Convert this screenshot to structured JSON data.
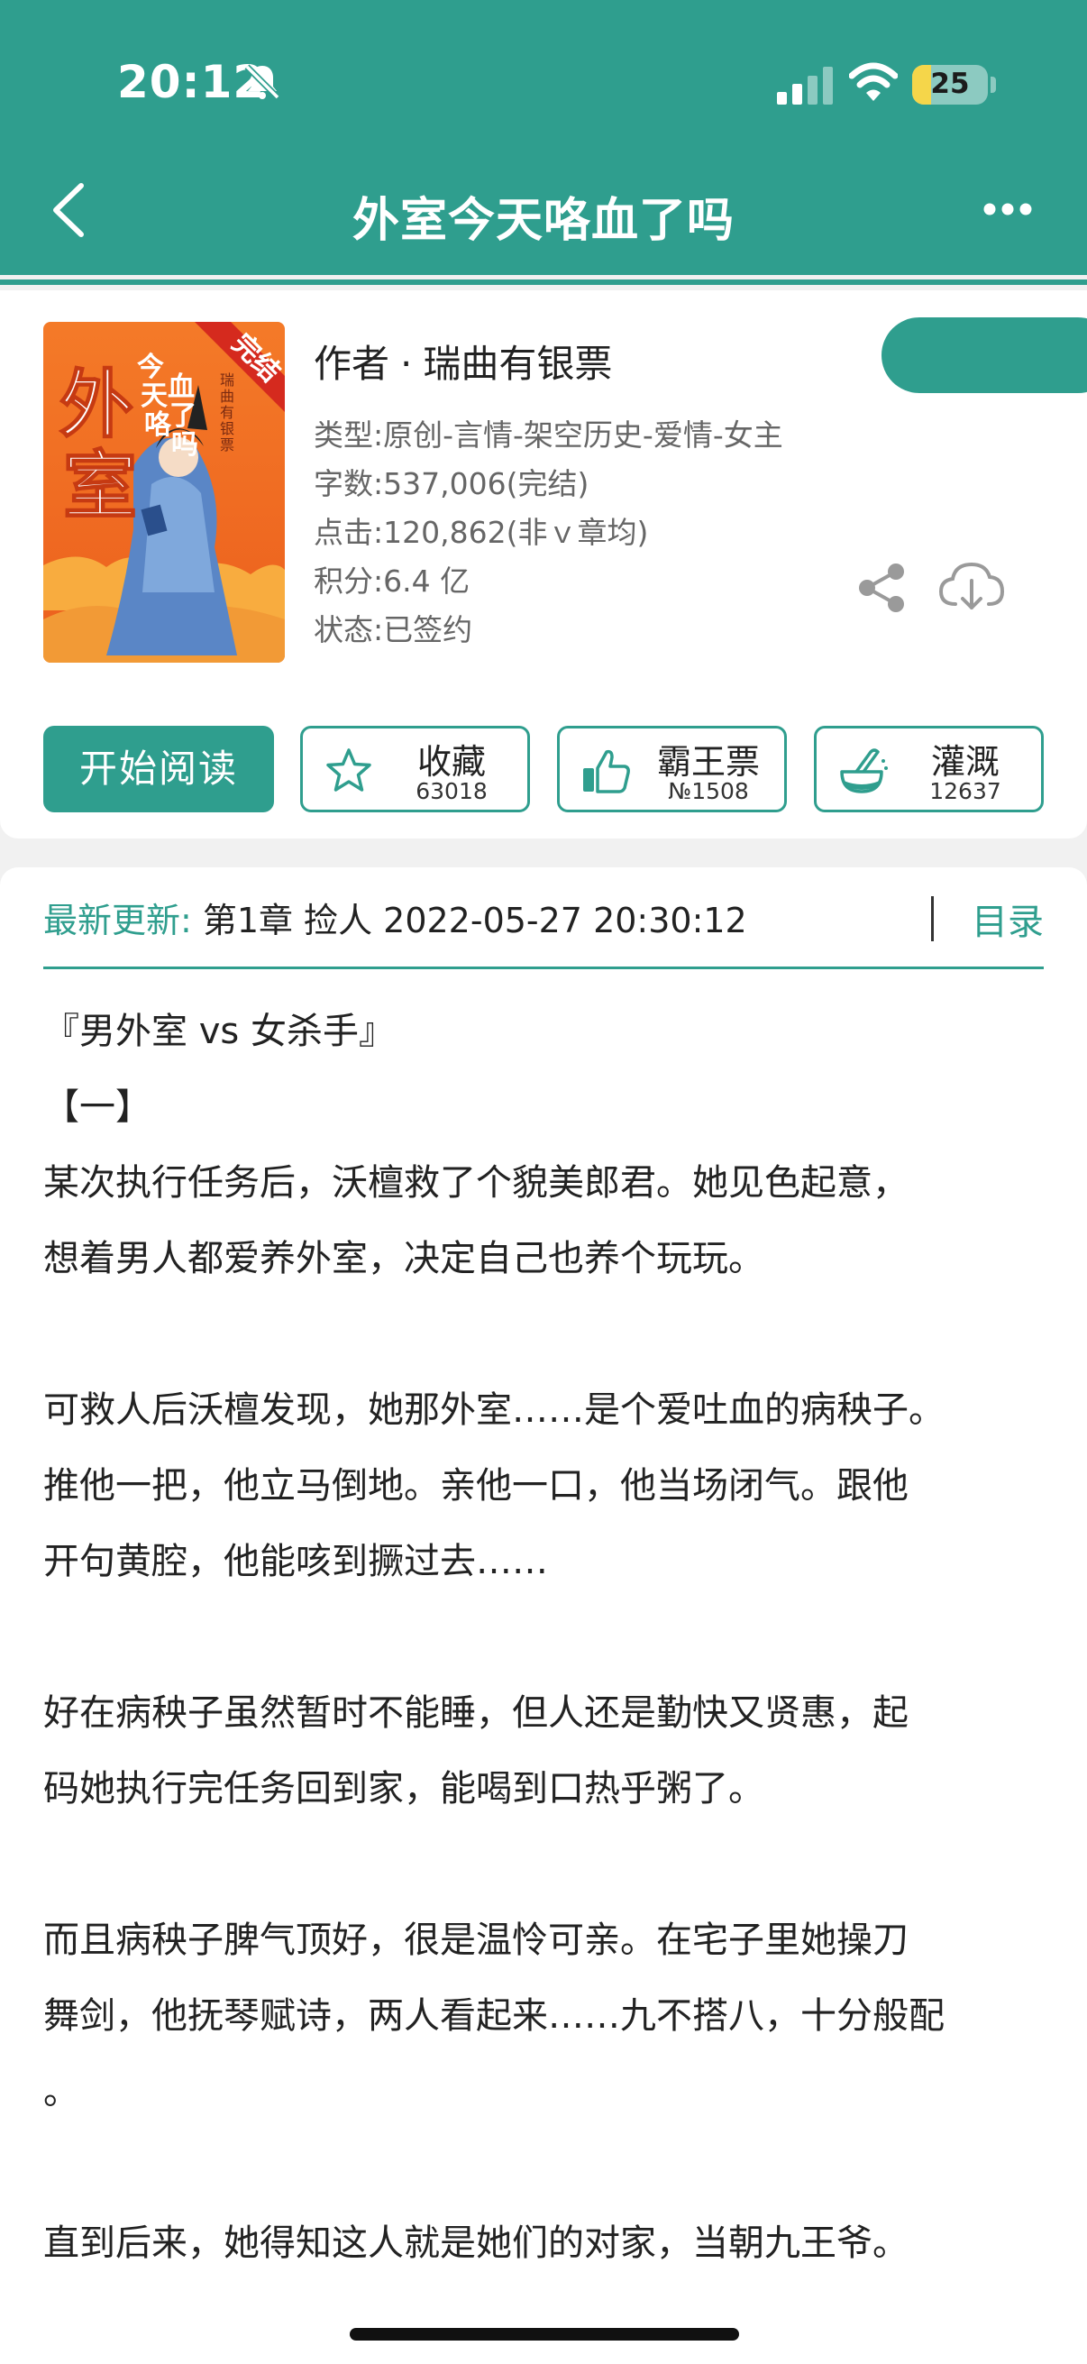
{
  "status_bar": {
    "time": "20:12",
    "battery_level": "25"
  },
  "header": {
    "title": "外室今天咯血了吗"
  },
  "book": {
    "cover_badge": "完结",
    "cover_title": "外室今天咯血了吗",
    "cover_author": "瑞曲有银票",
    "author_label": "作者",
    "author_sep": "·",
    "author_name": "瑞曲有银票",
    "meta": {
      "genre": "类型:原创-言情-架空历史-爱情-女主",
      "word_count": "字数:537,006(完结)",
      "clicks": "点击:120,862(非ｖ章均)",
      "score": "积分:6.4 亿",
      "status": "状态:已签约"
    }
  },
  "actions": {
    "read_label": "开始阅读",
    "collect_label": "收藏",
    "collect_count": "63018",
    "ticket_label": "霸王票",
    "ticket_count": "№1508",
    "water_label": "灌溉",
    "water_count": "12637"
  },
  "latest": {
    "label": "最新更新:",
    "text": "第1章 捡人 2022-05-27 20:30:12",
    "toc_label": "目录"
  },
  "intro": {
    "lines": [
      "『男外室 vs 女杀手』",
      "【一】",
      "某次执行任务后，沃檀救了个貌美郎君。她见色起意，",
      "想着男人都爱养外室，决定自己也养个玩玩。",
      "",
      "可救人后沃檀发现，她那外室……是个爱吐血的病秧子。",
      "推他一把，他立马倒地。亲他一口，他当场闭气。跟他",
      "开句黄腔，他能咳到撅过去……",
      "",
      "好在病秧子虽然暂时不能睡，但人还是勤快又贤惠，起",
      "码她执行完任务回到家，能喝到口热乎粥了。",
      "",
      "而且病秧子脾气顶好，很是温怜可亲。在宅子里她操刀",
      "舞剑，他抚琴赋诗，两人看起来……九不搭八，十分般配",
      "。",
      "",
      "直到后来，她得知这人就是她们的对家，当朝九王爷。"
    ]
  },
  "colors": {
    "accent": "#2f9e8e",
    "background": "#f1f1f1"
  }
}
